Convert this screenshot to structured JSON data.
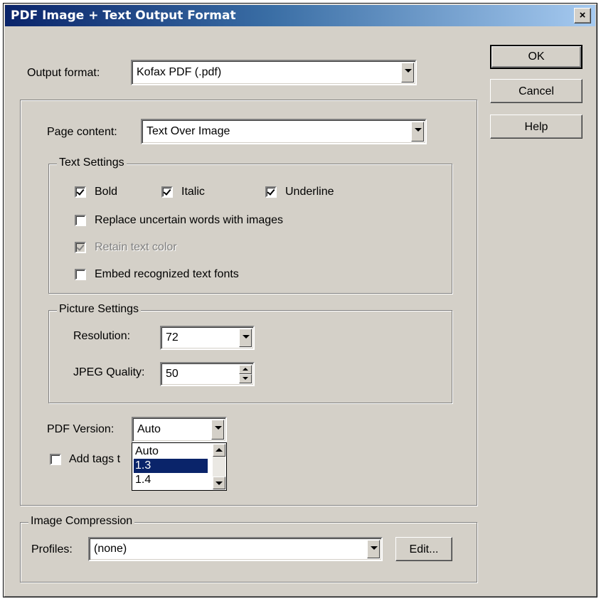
{
  "window": {
    "title": "PDF Image + Text Output Format",
    "close_glyph": "×"
  },
  "buttons": {
    "ok": "OK",
    "cancel": "Cancel",
    "help": "Help"
  },
  "output_format": {
    "label": "Output format:",
    "value": "Kofax PDF (.pdf)"
  },
  "page_content": {
    "label": "Page content:",
    "value": "Text Over Image"
  },
  "text_settings": {
    "title": "Text Settings",
    "bold": {
      "label": "Bold",
      "checked": true
    },
    "italic": {
      "label": "Italic",
      "checked": true
    },
    "underline": {
      "label": "Underline",
      "checked": true
    },
    "replace_uncertain": {
      "label": "Replace uncertain words with images",
      "checked": false
    },
    "retain_color": {
      "label": "Retain text color",
      "checked": true,
      "disabled": true
    },
    "embed_fonts": {
      "label": "Embed recognized text fonts",
      "checked": false
    }
  },
  "picture_settings": {
    "title": "Picture Settings",
    "resolution": {
      "label": "Resolution:",
      "value": "72"
    },
    "jpeg_quality": {
      "label": "JPEG Quality:",
      "value": "50"
    }
  },
  "pdf_version": {
    "label": "PDF Version:",
    "value": "Auto",
    "options": [
      "Auto",
      "1.3",
      "1.4"
    ],
    "selected_option": "1.3"
  },
  "add_tags": {
    "label": "Add tags t",
    "checked": false
  },
  "image_compression": {
    "title": "Image Compression",
    "profiles_label": "Profiles:",
    "profiles_value": "(none)",
    "edit_button": "Edit..."
  }
}
